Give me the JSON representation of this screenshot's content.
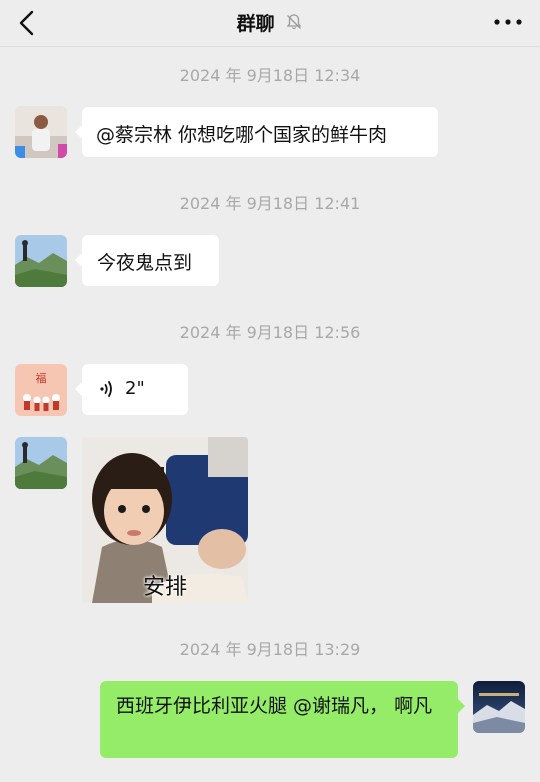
{
  "header": {
    "title": "群聊",
    "back_icon": "chevron-left-icon",
    "mute_icon": "bell-muted-icon",
    "more_icon": "more-dots-icon"
  },
  "messages": [
    {
      "type": "timestamp",
      "text": "2024 年 9月18日 12:34"
    },
    {
      "type": "text",
      "side": "left",
      "text": "@蔡宗林 你想吃哪个国家的鲜牛肉"
    },
    {
      "type": "timestamp",
      "text": "2024 年 9月18日 12:41"
    },
    {
      "type": "text",
      "side": "left",
      "text": "今夜鬼点到"
    },
    {
      "type": "timestamp",
      "text": "2024 年 9月18日 12:56"
    },
    {
      "type": "voice",
      "side": "left",
      "duration": "2\""
    },
    {
      "type": "sticker",
      "side": "left",
      "caption": "安排"
    },
    {
      "type": "timestamp",
      "text": "2024 年 9月18日 13:29"
    },
    {
      "type": "text",
      "side": "right",
      "text": "西班牙伊比利亚火腿 @谢瑞凡， 啊凡"
    }
  ],
  "colors": {
    "background": "#ededed",
    "bubble_left": "#ffffff",
    "bubble_right": "#95ec69",
    "timestamp": "#a8a8a8"
  }
}
